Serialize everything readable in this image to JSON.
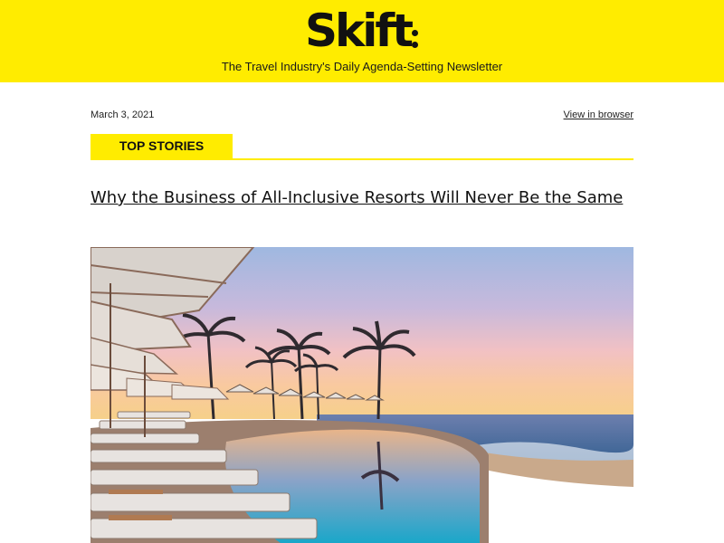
{
  "header": {
    "logo_text": "Skift",
    "tagline": "The Travel Industry's Daily Agenda-Setting Newsletter",
    "background_color": "#ffec00"
  },
  "meta": {
    "date": "March 3, 2021",
    "view_in_browser": "View in browser"
  },
  "section": {
    "label": "TOP STORIES",
    "accent_color": "#ffec00"
  },
  "story": {
    "headline": "Why the Business of All-Inclusive Resorts Will Never Be the Same",
    "image_subject": "infinity pool with lounge chairs and umbrellas at sunset by the ocean, palm trees"
  }
}
